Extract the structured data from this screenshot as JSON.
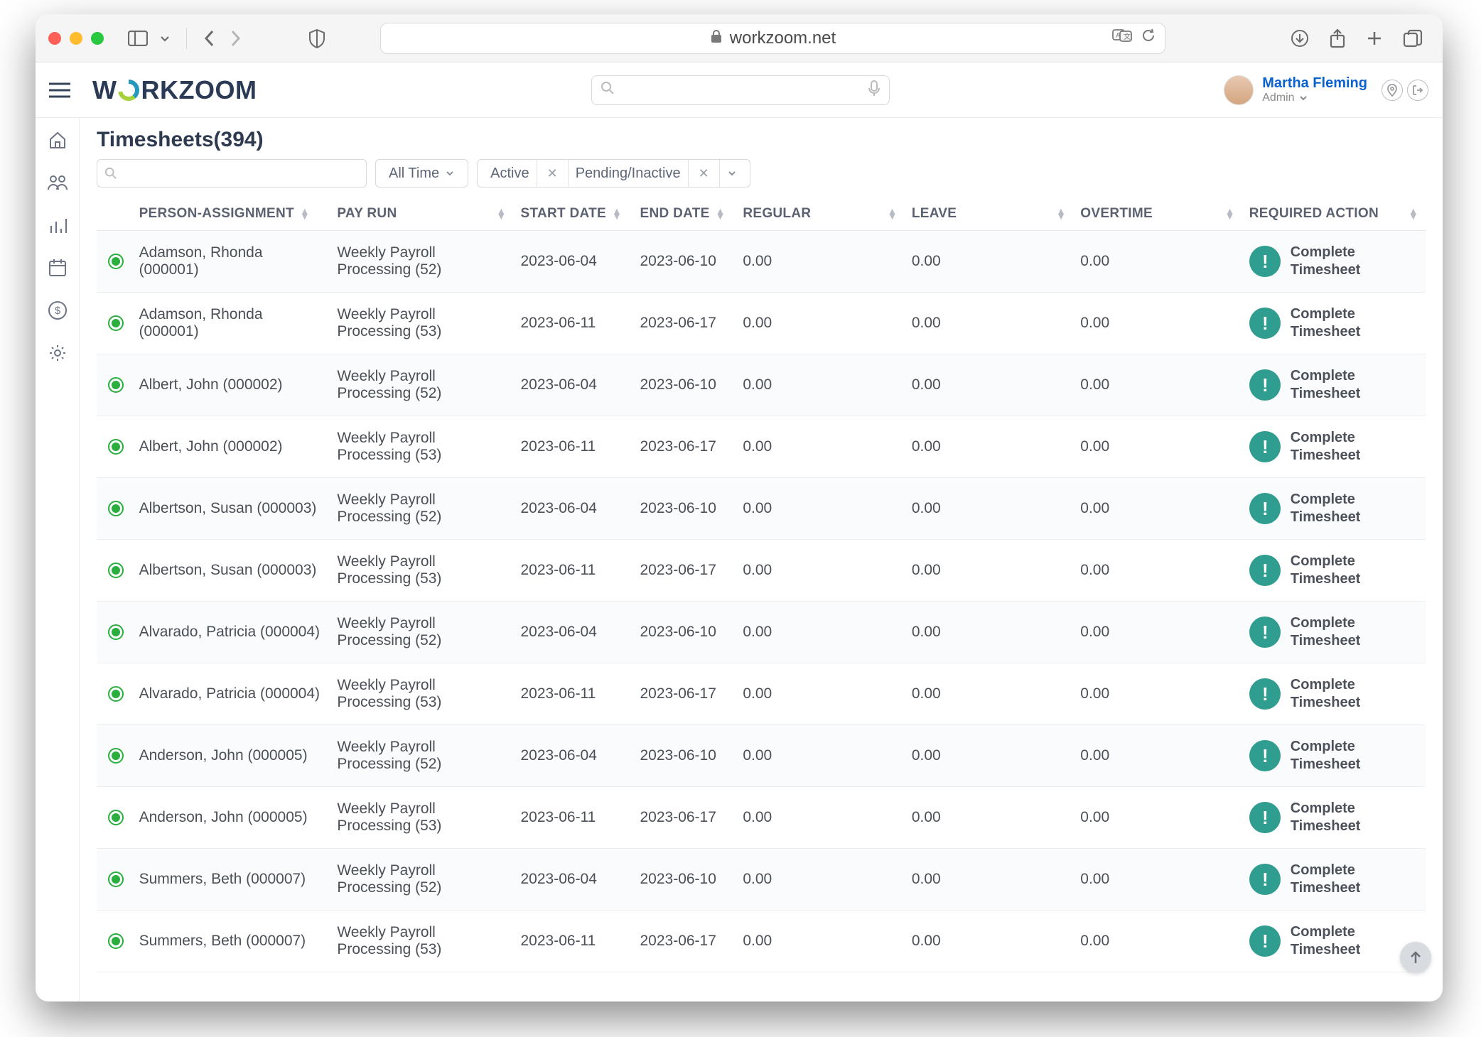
{
  "browser": {
    "url": "workzoom.net"
  },
  "header": {
    "logo_text_left": "W",
    "logo_text_right": "RKZOOM",
    "user_name": "Martha Fleming",
    "user_role": "Admin"
  },
  "page": {
    "title": "Timesheets(394)"
  },
  "filters": {
    "time_label": "All Time",
    "tag1": "Active",
    "tag2": "Pending/Inactive"
  },
  "columns": {
    "person": "PERSON-ASSIGNMENT",
    "payrun": "PAY RUN",
    "start": "START DATE",
    "end": "END DATE",
    "regular": "REGULAR",
    "leave": "LEAVE",
    "overtime": "OVERTIME",
    "action": "REQUIRED ACTION"
  },
  "action_label_line1": "Complete",
  "action_label_line2": "Timesheet",
  "rows": [
    {
      "person": "Adamson, Rhonda (000001)",
      "payrun": "Weekly Payroll Processing (52)",
      "start": "2023-06-04",
      "end": "2023-06-10",
      "regular": "0.00",
      "leave": "0.00",
      "overtime": "0.00"
    },
    {
      "person": "Adamson, Rhonda (000001)",
      "payrun": "Weekly Payroll Processing (53)",
      "start": "2023-06-11",
      "end": "2023-06-17",
      "regular": "0.00",
      "leave": "0.00",
      "overtime": "0.00"
    },
    {
      "person": "Albert, John (000002)",
      "payrun": "Weekly Payroll Processing (52)",
      "start": "2023-06-04",
      "end": "2023-06-10",
      "regular": "0.00",
      "leave": "0.00",
      "overtime": "0.00"
    },
    {
      "person": "Albert, John (000002)",
      "payrun": "Weekly Payroll Processing (53)",
      "start": "2023-06-11",
      "end": "2023-06-17",
      "regular": "0.00",
      "leave": "0.00",
      "overtime": "0.00"
    },
    {
      "person": "Albertson, Susan (000003)",
      "payrun": "Weekly Payroll Processing (52)",
      "start": "2023-06-04",
      "end": "2023-06-10",
      "regular": "0.00",
      "leave": "0.00",
      "overtime": "0.00"
    },
    {
      "person": "Albertson, Susan (000003)",
      "payrun": "Weekly Payroll Processing (53)",
      "start": "2023-06-11",
      "end": "2023-06-17",
      "regular": "0.00",
      "leave": "0.00",
      "overtime": "0.00"
    },
    {
      "person": "Alvarado, Patricia (000004)",
      "payrun": "Weekly Payroll Processing (52)",
      "start": "2023-06-04",
      "end": "2023-06-10",
      "regular": "0.00",
      "leave": "0.00",
      "overtime": "0.00"
    },
    {
      "person": "Alvarado, Patricia (000004)",
      "payrun": "Weekly Payroll Processing (53)",
      "start": "2023-06-11",
      "end": "2023-06-17",
      "regular": "0.00",
      "leave": "0.00",
      "overtime": "0.00"
    },
    {
      "person": "Anderson, John (000005)",
      "payrun": "Weekly Payroll Processing (52)",
      "start": "2023-06-04",
      "end": "2023-06-10",
      "regular": "0.00",
      "leave": "0.00",
      "overtime": "0.00"
    },
    {
      "person": "Anderson, John (000005)",
      "payrun": "Weekly Payroll Processing (53)",
      "start": "2023-06-11",
      "end": "2023-06-17",
      "regular": "0.00",
      "leave": "0.00",
      "overtime": "0.00"
    },
    {
      "person": "Summers, Beth (000007)",
      "payrun": "Weekly Payroll Processing (52)",
      "start": "2023-06-04",
      "end": "2023-06-10",
      "regular": "0.00",
      "leave": "0.00",
      "overtime": "0.00"
    },
    {
      "person": "Summers, Beth (000007)",
      "payrun": "Weekly Payroll Processing (53)",
      "start": "2023-06-11",
      "end": "2023-06-17",
      "regular": "0.00",
      "leave": "0.00",
      "overtime": "0.00"
    }
  ]
}
